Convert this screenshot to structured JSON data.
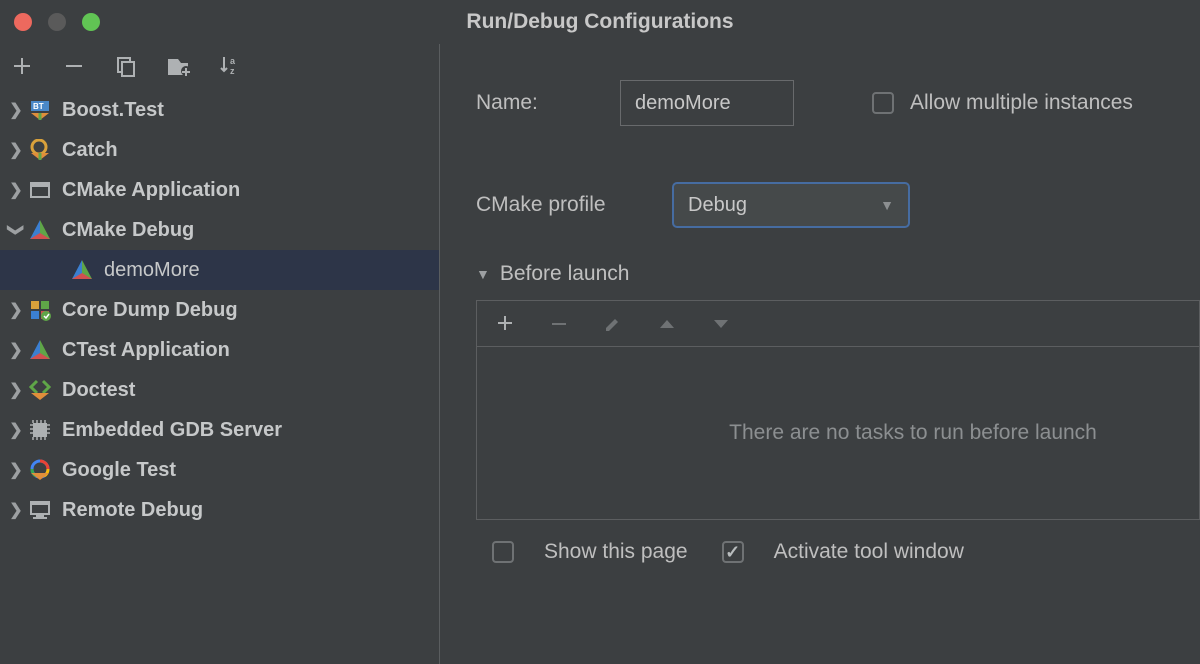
{
  "window": {
    "title": "Run/Debug Configurations",
    "traffic_lights": {
      "close": "#ed695e",
      "minimize": "#5a5a5a",
      "zoom": "#61c454"
    }
  },
  "sidebar": {
    "items": [
      {
        "label": "Boost.Test",
        "expanded": false,
        "selected": false,
        "icon": "boost-test"
      },
      {
        "label": "Catch",
        "expanded": false,
        "selected": false,
        "icon": "catch"
      },
      {
        "label": "CMake Application",
        "expanded": false,
        "selected": false,
        "icon": "cmake-app"
      },
      {
        "label": "CMake Debug",
        "expanded": true,
        "selected": false,
        "icon": "cmake-debug"
      },
      {
        "label": "demoMore",
        "expanded": false,
        "selected": true,
        "child": true,
        "icon": "cmake-debug"
      },
      {
        "label": "Core Dump Debug",
        "expanded": false,
        "selected": false,
        "icon": "core-dump"
      },
      {
        "label": "CTest Application",
        "expanded": false,
        "selected": false,
        "icon": "ctest"
      },
      {
        "label": "Doctest",
        "expanded": false,
        "selected": false,
        "icon": "doctest"
      },
      {
        "label": "Embedded GDB Server",
        "expanded": false,
        "selected": false,
        "icon": "embedded"
      },
      {
        "label": "Google Test",
        "expanded": false,
        "selected": false,
        "icon": "google-test"
      },
      {
        "label": "Remote Debug",
        "expanded": false,
        "selected": false,
        "icon": "remote-debug"
      }
    ]
  },
  "form": {
    "name_label": "Name:",
    "name_value": "demoMore",
    "allow_multiple_label": "Allow multiple instances",
    "allow_multiple_checked": false,
    "profile_label": "CMake profile",
    "profile_value": "Debug",
    "before_launch_label": "Before launch",
    "before_launch_empty": "There are no tasks to run before launch",
    "show_page_label": "Show this page",
    "show_page_checked": false,
    "activate_tool_label": "Activate tool window",
    "activate_tool_checked": true
  }
}
